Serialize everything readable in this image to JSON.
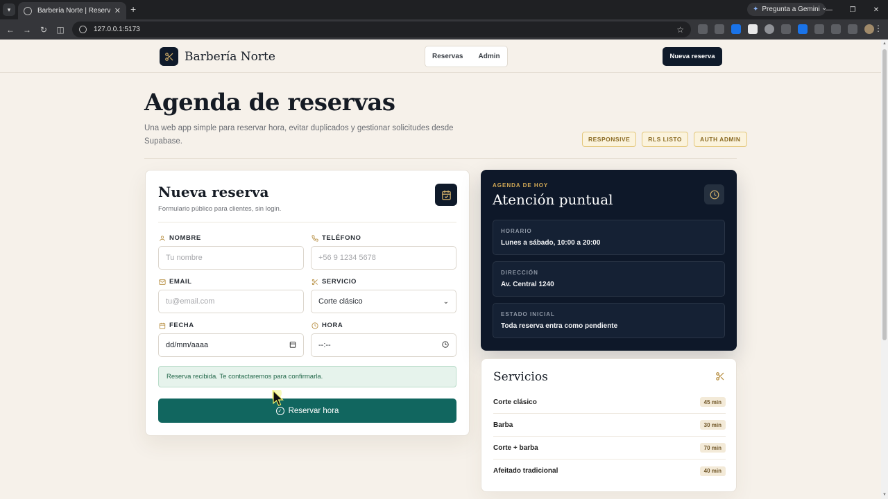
{
  "browser": {
    "tab_title": "Barbería Norte | Reservas",
    "url": "127.0.0.1:5173",
    "gemini_label": "Pregunta a Gemini"
  },
  "header": {
    "brand_name": "Barbería Norte",
    "nav": [
      "Reservas",
      "Admin"
    ],
    "cta": "Nueva reserva"
  },
  "hero": {
    "title": "Agenda de reservas",
    "subtitle": "Una web app simple para reservar hora, evitar duplicados y gestionar solicitudes desde Supabase.",
    "badges": [
      "RESPONSIVE",
      "RLS LISTO",
      "AUTH ADMIN"
    ]
  },
  "form": {
    "title": "Nueva reserva",
    "subtitle": "Formulario público para clientes, sin login.",
    "nombre_label": "NOMBRE",
    "nombre_placeholder": "Tu nombre",
    "telefono_label": "TELÉFONO",
    "telefono_placeholder": "+56 9 1234 5678",
    "email_label": "EMAIL",
    "email_placeholder": "tu@email.com",
    "servicio_label": "SERVICIO",
    "servicio_value": "Corte clásico",
    "fecha_label": "FECHA",
    "fecha_value": "dd/mm/aaaa",
    "hora_label": "HORA",
    "hora_value": "--:--",
    "success": "Reserva recibida. Te contactaremos para confirmarla.",
    "submit": "Reservar hora"
  },
  "agenda": {
    "eyebrow": "AGENDA DE HOY",
    "title": "Atención puntual",
    "items": [
      {
        "key": "HORARIO",
        "value": "Lunes a sábado, 10:00 a 20:00"
      },
      {
        "key": "DIRECCIÓN",
        "value": "Av. Central 1240"
      },
      {
        "key": "ESTADO INICIAL",
        "value": "Toda reserva entra como pendiente"
      }
    ]
  },
  "servicios": {
    "title": "Servicios",
    "items": [
      {
        "name": "Corte clásico",
        "duration": "45 min"
      },
      {
        "name": "Barba",
        "duration": "30 min"
      },
      {
        "name": "Corte + barba",
        "duration": "70 min"
      },
      {
        "name": "Afeitado tradicional",
        "duration": "40 min"
      }
    ]
  },
  "colors": {
    "navy": "#0f1a2a",
    "teal": "#11665f",
    "gold": "#b48a3a",
    "background": "#f6f1ea"
  }
}
